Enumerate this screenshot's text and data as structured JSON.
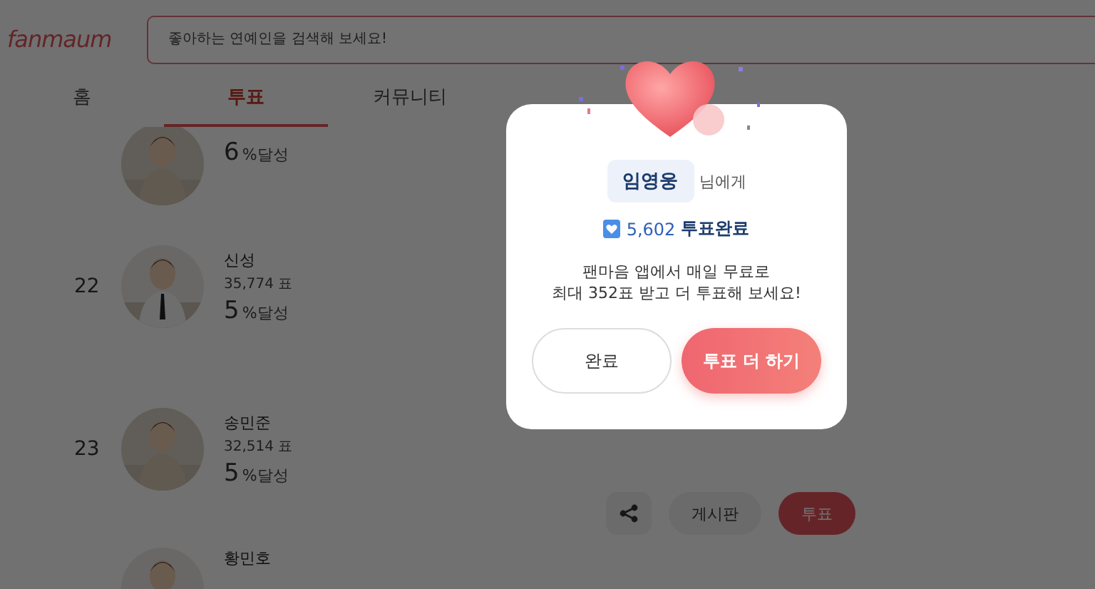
{
  "header": {
    "logo": "fanmaum",
    "search": {
      "placeholder": "좋아하는 연예인을 검색해 보세요!"
    }
  },
  "tabs": [
    {
      "label": "홈",
      "selected": false
    },
    {
      "label": "투표",
      "selected": true
    },
    {
      "label": "커뮤니티",
      "selected": false
    }
  ],
  "ranking": [
    {
      "percent": "6",
      "percent_unit": "%",
      "percent_label": "달성"
    },
    {
      "rank": "22",
      "name": "신성",
      "votes": "35,774 표",
      "percent": "5",
      "percent_unit": "%",
      "percent_label": "달성"
    },
    {
      "rank": "23",
      "name": "송민준",
      "votes": "32,514 표",
      "percent": "5",
      "percent_unit": "%",
      "percent_label": "달성"
    },
    {
      "name": "황민호"
    }
  ],
  "action_bar": {
    "board": "게시판",
    "vote": "투표"
  },
  "modal": {
    "recipient": "임영웅",
    "recipient_suffix": "님에게",
    "vote_count": "5,602",
    "vote_status": "투표완료",
    "message": [
      "팬마음 앱에서 매일 무료로",
      "최대 352표 받고 더 투표해 보세요!"
    ],
    "buttons": [
      {
        "label": "완료",
        "kind": "secondary"
      },
      {
        "label": "투표 더 하기",
        "kind": "primary"
      }
    ]
  }
}
